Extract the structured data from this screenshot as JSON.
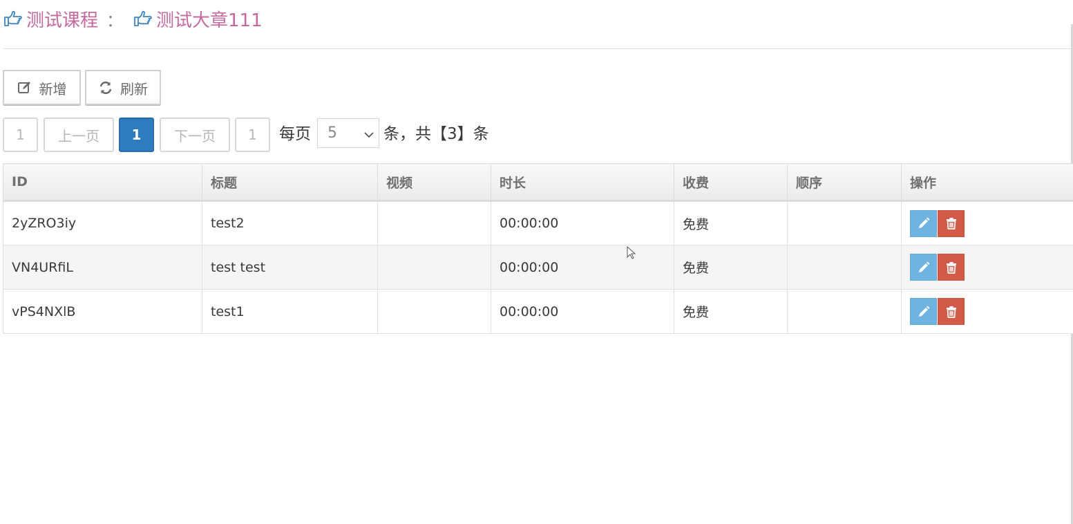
{
  "breadcrumb": {
    "course_label": "测试课程",
    "separator": "：",
    "chapter_label": "测试大章111",
    "icon": "hand-point-right-icon",
    "color": "#c6699f"
  },
  "toolbar": {
    "add_label": "新增",
    "add_icon": "edit-icon",
    "refresh_label": "刷新",
    "refresh_icon": "refresh-icon"
  },
  "pagination": {
    "first_label": "1",
    "prev_label": "上一页",
    "current_label": "1",
    "next_label": "下一页",
    "last_label": "1",
    "per_page_prefix": "每页",
    "per_page_value": "5",
    "total_text": "条，共【3】条",
    "active_color": "#2f7bbf"
  },
  "table": {
    "columns": [
      "ID",
      "标题",
      "视频",
      "时长",
      "收费",
      "顺序",
      "操作"
    ],
    "rows": [
      {
        "id": "2yZRO3iy",
        "title": "test2",
        "video": "",
        "duration": "00:00:00",
        "charge": "免费",
        "order": ""
      },
      {
        "id": "VN4URfiL",
        "title": "test test",
        "video": "",
        "duration": "00:00:00",
        "charge": "免费",
        "order": ""
      },
      {
        "id": "vPS4NXlB",
        "title": "test1",
        "video": "",
        "duration": "00:00:00",
        "charge": "免费",
        "order": ""
      }
    ],
    "edit_icon": "pencil-icon",
    "delete_icon": "trash-icon",
    "edit_color": "#6fb3e0",
    "delete_color": "#d15b47"
  }
}
